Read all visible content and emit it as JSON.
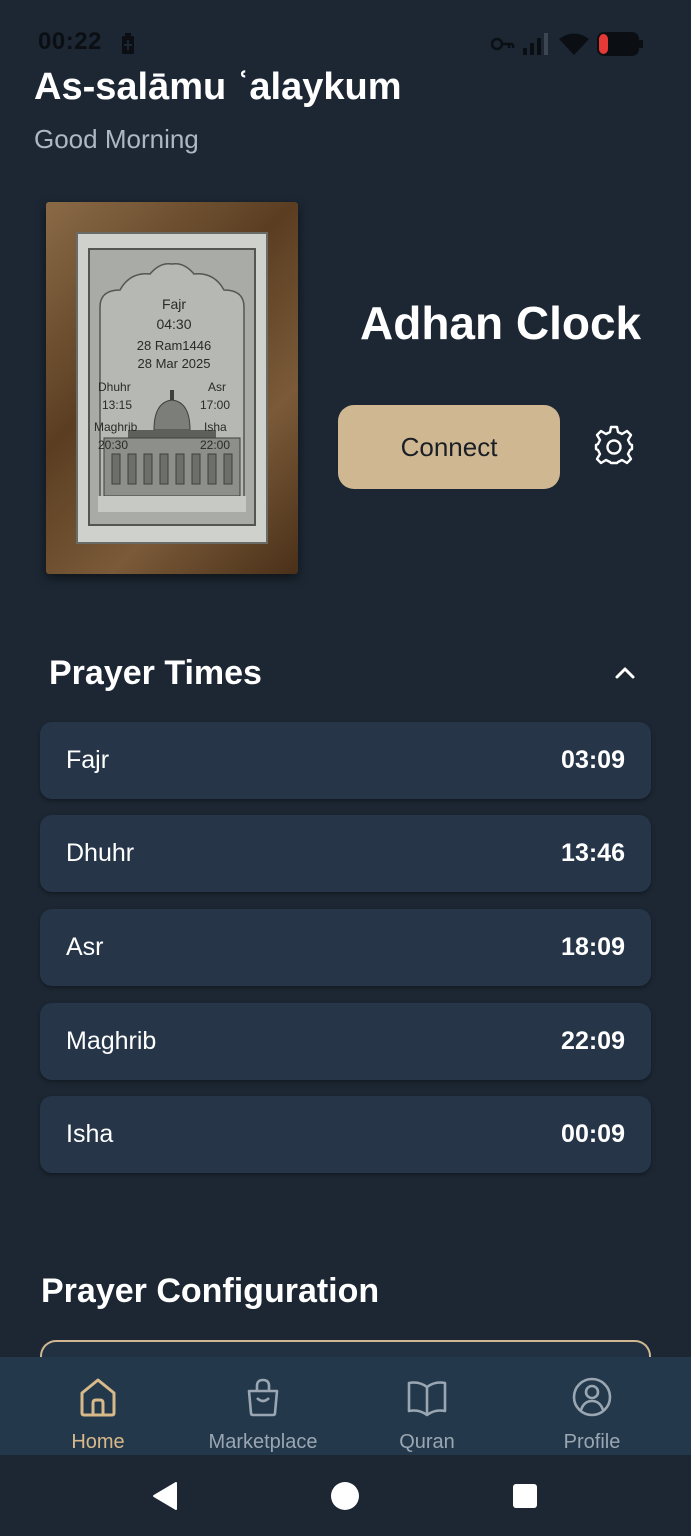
{
  "status_bar": {
    "time": "00:22"
  },
  "header": {
    "greeting": "As-salāmu ʿalaykum",
    "subgreeting": "Good Morning"
  },
  "device": {
    "title": "Adhan Clock",
    "connect_label": "Connect",
    "preview": {
      "prayer": "Fajr",
      "time": "04:30",
      "hijri_date": "28 Ram1446",
      "gregorian_date": "28 Mar 2025",
      "dhuhr_label": "Dhuhr",
      "dhuhr_time": "13:15",
      "asr_label": "Asr",
      "asr_time": "17:00",
      "maghrib_label": "Maghrib",
      "maghrib_time": "20:30",
      "isha_label": "Isha",
      "isha_time": "22:00"
    }
  },
  "prayer_times": {
    "title": "Prayer Times",
    "items": [
      {
        "name": "Fajr",
        "time": "03:09"
      },
      {
        "name": "Dhuhr",
        "time": "13:46"
      },
      {
        "name": "Asr",
        "time": "18:09"
      },
      {
        "name": "Maghrib",
        "time": "22:09"
      },
      {
        "name": "Isha",
        "time": "00:09"
      }
    ]
  },
  "prayer_configuration": {
    "title": "Prayer Configuration"
  },
  "bottom_nav": {
    "items": [
      {
        "label": "Home",
        "icon": "home-icon",
        "active": true
      },
      {
        "label": "Marketplace",
        "icon": "shopping-bag-icon",
        "active": false
      },
      {
        "label": "Quran",
        "icon": "book-icon",
        "active": false
      },
      {
        "label": "Profile",
        "icon": "profile-icon",
        "active": false
      }
    ]
  },
  "colors": {
    "background": "#1c2733",
    "card": "#263648",
    "accent": "#cfb792",
    "nav_active": "#d8b98a"
  }
}
